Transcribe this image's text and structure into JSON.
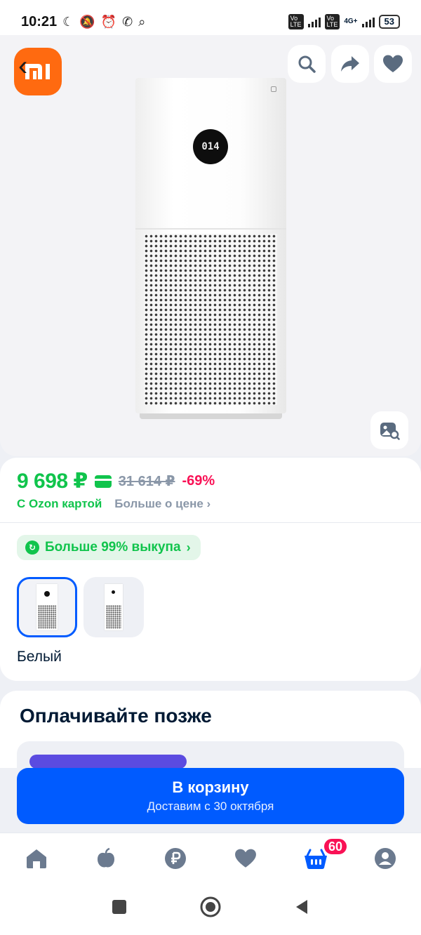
{
  "status_bar": {
    "time": "10:21",
    "battery": "53",
    "network": "4G+"
  },
  "image_area": {
    "brand": "Xiaomi",
    "display_readout": "014",
    "buttons": [
      "back-icon",
      "search-icon",
      "share-icon",
      "heart-icon",
      "photo-search-icon"
    ]
  },
  "price": {
    "current": "9 698 ₽",
    "old": "31 614 ₽",
    "discount": "-69%",
    "ozon_card_label": "С Ozon картой",
    "more_price": "Больше о цене"
  },
  "buyout": {
    "text": "Больше 99% выкупа"
  },
  "variants": {
    "color_label": "Белый"
  },
  "pay_later": {
    "title": "Оплачивайте позже"
  },
  "cart_button": {
    "label": "В корзину",
    "subtitle": "Доставим с 30 октября"
  },
  "bottom_nav": {
    "items": [
      "home-icon",
      "fresh-icon",
      "finance-icon",
      "favorites-icon",
      "cart-icon",
      "profile-icon"
    ],
    "cart_badge": "60"
  },
  "colors": {
    "accent": "#005bff",
    "price_green": "#10c44c",
    "discount_pink": "#f91155"
  }
}
